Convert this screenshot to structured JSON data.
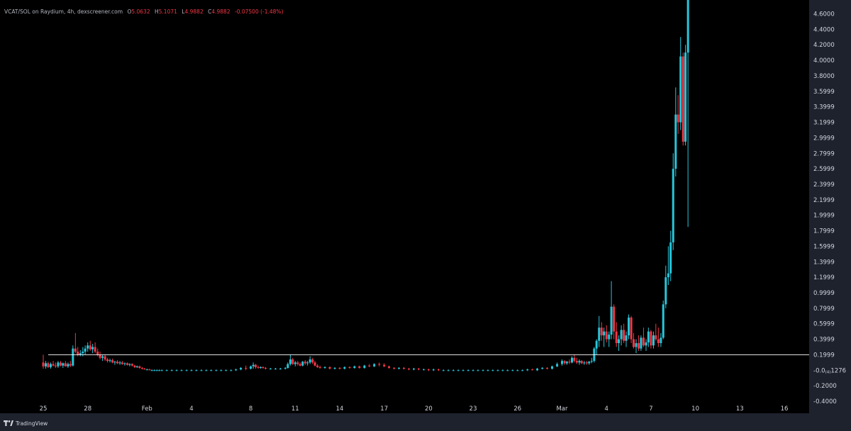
{
  "legend": {
    "symbol": "VCAT/SOL on Raydium, 4h, dexscreener.com",
    "o_label": "O",
    "o_value": "5.0632",
    "h_label": "H",
    "h_value": "5.1071",
    "l_label": "L",
    "l_value": "4.9882",
    "c_label": "C",
    "c_value": "4.9882",
    "change": "-0.07500 (-1.48%)"
  },
  "footer": {
    "brand": "TradingView"
  },
  "colors": {
    "up": "#26c6da",
    "down": "#f23645",
    "background": "#000000",
    "frame": "#1e222d",
    "axis_text": "#d1d4dc",
    "reference_line": "#ffffff"
  },
  "chart_data": {
    "type": "candlestick",
    "title": "",
    "xlabel": "",
    "ylabel": "",
    "interval": "4h",
    "y_tick_labels": [
      "4.6000",
      "4.4000",
      "4.2000",
      "4.0000",
      "3.8000",
      "3.5999",
      "3.3999",
      "3.1999",
      "2.9999",
      "2.7999",
      "2.5999",
      "2.3999",
      "2.1999",
      "1.9999",
      "1.7999",
      "1.5999",
      "1.3999",
      "1.1999",
      "0.9999",
      "0.7999",
      "0.5999",
      "0.3999",
      "0.1999",
      "-0.0001276",
      "-0.2000",
      "-0.4000"
    ],
    "y_tick_values": [
      4.6,
      4.4,
      4.2,
      4.0,
      3.8,
      3.5999,
      3.3999,
      3.1999,
      2.9999,
      2.7999,
      2.5999,
      2.3999,
      2.1999,
      1.9999,
      1.7999,
      1.5999,
      1.3999,
      1.1999,
      0.9999,
      0.7999,
      0.5999,
      0.3999,
      0.1999,
      -0.0001276,
      -0.2,
      -0.4
    ],
    "current_price_label": "-0.0001276",
    "x_tick_labels": [
      "25",
      "28",
      "Feb",
      "4",
      "8",
      "11",
      "14",
      "17",
      "20",
      "23",
      "26",
      "Mar",
      "4",
      "7",
      "10",
      "13",
      "16"
    ],
    "x_tick_days": [
      0,
      3,
      7,
      10,
      14,
      17,
      20,
      23,
      26,
      29,
      32,
      35,
      38,
      41,
      44,
      47,
      50
    ],
    "ylim": [
      -0.4,
      4.8
    ],
    "xlim_days": [
      -0.7,
      54.2
    ],
    "reference_line_value": 0.2,
    "grid": false,
    "candles_note": "approximate 4h candles; day = days since Jan 25 (first x tick)",
    "candles": [
      [
        0.0,
        0.1,
        0.2,
        0.02,
        0.05
      ],
      [
        0.17,
        0.05,
        0.12,
        0.02,
        0.09
      ],
      [
        0.33,
        0.09,
        0.11,
        0.03,
        0.04
      ],
      [
        0.5,
        0.04,
        0.1,
        0.02,
        0.08
      ],
      [
        0.67,
        0.08,
        0.12,
        0.05,
        0.06
      ],
      [
        0.83,
        0.06,
        0.1,
        0.03,
        0.05
      ],
      [
        1.0,
        0.05,
        0.12,
        0.03,
        0.1
      ],
      [
        1.17,
        0.1,
        0.12,
        0.05,
        0.06
      ],
      [
        1.33,
        0.06,
        0.1,
        0.03,
        0.09
      ],
      [
        1.5,
        0.09,
        0.12,
        0.05,
        0.05
      ],
      [
        1.67,
        0.05,
        0.1,
        0.03,
        0.08
      ],
      [
        1.83,
        0.08,
        0.12,
        0.04,
        0.06
      ],
      [
        2.0,
        0.06,
        0.32,
        0.05,
        0.28
      ],
      [
        2.17,
        0.28,
        0.48,
        0.22,
        0.24
      ],
      [
        2.33,
        0.24,
        0.3,
        0.18,
        0.2
      ],
      [
        2.5,
        0.2,
        0.26,
        0.18,
        0.22
      ],
      [
        2.67,
        0.22,
        0.3,
        0.18,
        0.24
      ],
      [
        2.83,
        0.24,
        0.32,
        0.2,
        0.28
      ],
      [
        3.0,
        0.28,
        0.36,
        0.24,
        0.32
      ],
      [
        3.17,
        0.32,
        0.38,
        0.25,
        0.27
      ],
      [
        3.33,
        0.27,
        0.34,
        0.22,
        0.3
      ],
      [
        3.5,
        0.3,
        0.36,
        0.22,
        0.24
      ],
      [
        3.67,
        0.24,
        0.28,
        0.18,
        0.2
      ],
      [
        3.83,
        0.2,
        0.24,
        0.14,
        0.16
      ],
      [
        4.0,
        0.16,
        0.2,
        0.12,
        0.18
      ],
      [
        4.17,
        0.18,
        0.2,
        0.12,
        0.14
      ],
      [
        4.33,
        0.14,
        0.16,
        0.1,
        0.12
      ],
      [
        4.5,
        0.12,
        0.15,
        0.1,
        0.13
      ],
      [
        4.67,
        0.13,
        0.15,
        0.09,
        0.1
      ],
      [
        4.83,
        0.1,
        0.12,
        0.07,
        0.11
      ],
      [
        5.0,
        0.11,
        0.13,
        0.08,
        0.09
      ],
      [
        5.17,
        0.09,
        0.12,
        0.07,
        0.1
      ],
      [
        5.33,
        0.1,
        0.12,
        0.07,
        0.08
      ],
      [
        5.5,
        0.08,
        0.1,
        0.06,
        0.09
      ],
      [
        5.67,
        0.09,
        0.1,
        0.06,
        0.07
      ],
      [
        5.83,
        0.07,
        0.09,
        0.05,
        0.08
      ],
      [
        6.0,
        0.08,
        0.09,
        0.05,
        0.06
      ],
      [
        6.17,
        0.06,
        0.07,
        0.03,
        0.04
      ],
      [
        6.33,
        0.04,
        0.06,
        0.03,
        0.05
      ],
      [
        6.5,
        0.05,
        0.06,
        0.02,
        0.03
      ],
      [
        6.67,
        0.03,
        0.04,
        0.01,
        0.02
      ],
      [
        6.83,
        0.02,
        0.03,
        0.01,
        0.01
      ],
      [
        7.0,
        0.01,
        0.02,
        0.0,
        0.01
      ],
      [
        7.17,
        0.01,
        0.02,
        0.0,
        0.0
      ],
      [
        7.33,
        0.0,
        0.01,
        -0.01,
        0.0
      ],
      [
        7.5,
        0.0,
        0.01,
        -0.01,
        0.0
      ],
      [
        7.67,
        0.0,
        0.01,
        -0.01,
        0.0
      ],
      [
        7.83,
        0.0,
        0.01,
        -0.01,
        0.0
      ],
      [
        8.0,
        0.0,
        0.01,
        -0.01,
        0.0
      ],
      [
        8.33,
        0.0,
        0.01,
        -0.01,
        0.0
      ],
      [
        8.67,
        0.0,
        0.01,
        -0.01,
        0.0
      ],
      [
        9.0,
        0.0,
        0.01,
        -0.01,
        0.0
      ],
      [
        9.33,
        0.0,
        0.01,
        -0.01,
        0.0
      ],
      [
        9.67,
        0.0,
        0.01,
        -0.01,
        0.0
      ],
      [
        10.0,
        0.0,
        0.01,
        -0.01,
        0.0
      ],
      [
        10.33,
        0.0,
        0.01,
        -0.01,
        0.0
      ],
      [
        10.67,
        0.0,
        0.01,
        -0.01,
        0.0
      ],
      [
        11.0,
        0.0,
        0.01,
        -0.01,
        0.0
      ],
      [
        11.33,
        0.0,
        0.01,
        -0.01,
        0.0
      ],
      [
        11.67,
        0.0,
        0.01,
        -0.01,
        0.0
      ],
      [
        12.0,
        0.0,
        0.01,
        -0.01,
        0.0
      ],
      [
        12.33,
        0.0,
        0.01,
        -0.01,
        0.0
      ],
      [
        12.67,
        0.0,
        0.01,
        -0.01,
        0.0
      ],
      [
        13.0,
        0.0,
        0.02,
        -0.01,
        0.01
      ],
      [
        13.33,
        0.01,
        0.04,
        0.0,
        0.03
      ],
      [
        13.67,
        0.03,
        0.06,
        0.0,
        0.02
      ],
      [
        14.0,
        0.02,
        0.06,
        0.01,
        0.05
      ],
      [
        14.17,
        0.05,
        0.1,
        0.02,
        0.07
      ],
      [
        14.33,
        0.07,
        0.08,
        0.02,
        0.04
      ],
      [
        14.5,
        0.04,
        0.06,
        0.02,
        0.03
      ],
      [
        14.67,
        0.03,
        0.05,
        0.02,
        0.04
      ],
      [
        14.83,
        0.04,
        0.05,
        0.02,
        0.03
      ],
      [
        15.0,
        0.03,
        0.04,
        0.01,
        0.02
      ],
      [
        15.33,
        0.02,
        0.03,
        0.01,
        0.02
      ],
      [
        15.67,
        0.02,
        0.03,
        0.01,
        0.02
      ],
      [
        16.0,
        0.02,
        0.03,
        0.01,
        0.02
      ],
      [
        16.33,
        0.02,
        0.04,
        0.01,
        0.03
      ],
      [
        16.5,
        0.03,
        0.1,
        0.02,
        0.08
      ],
      [
        16.67,
        0.08,
        0.2,
        0.06,
        0.14
      ],
      [
        16.83,
        0.14,
        0.16,
        0.07,
        0.08
      ],
      [
        17.0,
        0.08,
        0.12,
        0.05,
        0.1
      ],
      [
        17.17,
        0.1,
        0.12,
        0.06,
        0.08
      ],
      [
        17.33,
        0.08,
        0.1,
        0.05,
        0.06
      ],
      [
        17.5,
        0.06,
        0.12,
        0.05,
        0.11
      ],
      [
        17.67,
        0.11,
        0.13,
        0.07,
        0.09
      ],
      [
        17.83,
        0.09,
        0.12,
        0.06,
        0.1
      ],
      [
        18.0,
        0.1,
        0.18,
        0.08,
        0.14
      ],
      [
        18.17,
        0.14,
        0.16,
        0.08,
        0.1
      ],
      [
        18.33,
        0.1,
        0.12,
        0.05,
        0.06
      ],
      [
        18.5,
        0.06,
        0.08,
        0.03,
        0.04
      ],
      [
        18.67,
        0.04,
        0.06,
        0.02,
        0.03
      ],
      [
        19.0,
        0.03,
        0.05,
        0.02,
        0.04
      ],
      [
        19.33,
        0.04,
        0.05,
        0.01,
        0.02
      ],
      [
        19.67,
        0.02,
        0.04,
        0.01,
        0.03
      ],
      [
        20.0,
        0.03,
        0.04,
        0.01,
        0.02
      ],
      [
        20.33,
        0.02,
        0.05,
        0.01,
        0.04
      ],
      [
        20.67,
        0.04,
        0.05,
        0.02,
        0.03
      ],
      [
        21.0,
        0.03,
        0.06,
        0.02,
        0.05
      ],
      [
        21.33,
        0.05,
        0.06,
        0.02,
        0.03
      ],
      [
        21.67,
        0.03,
        0.07,
        0.02,
        0.06
      ],
      [
        22.0,
        0.06,
        0.08,
        0.04,
        0.05
      ],
      [
        22.33,
        0.05,
        0.09,
        0.04,
        0.08
      ],
      [
        22.67,
        0.08,
        0.1,
        0.05,
        0.07
      ],
      [
        23.0,
        0.07,
        0.09,
        0.04,
        0.05
      ],
      [
        23.33,
        0.05,
        0.06,
        0.02,
        0.03
      ],
      [
        23.67,
        0.03,
        0.04,
        0.01,
        0.02
      ],
      [
        24.0,
        0.02,
        0.04,
        0.01,
        0.03
      ],
      [
        24.33,
        0.03,
        0.04,
        0.01,
        0.02
      ],
      [
        24.67,
        0.02,
        0.03,
        0.0,
        0.01
      ],
      [
        25.0,
        0.01,
        0.03,
        0.0,
        0.02
      ],
      [
        25.33,
        0.02,
        0.03,
        0.0,
        0.01
      ],
      [
        25.67,
        0.01,
        0.02,
        0.0,
        0.01
      ],
      [
        26.0,
        0.01,
        0.02,
        -0.01,
        0.0
      ],
      [
        26.33,
        0.0,
        0.02,
        -0.01,
        0.01
      ],
      [
        26.67,
        0.01,
        0.02,
        -0.01,
        0.0
      ],
      [
        27.0,
        0.0,
        0.01,
        -0.01,
        0.0
      ],
      [
        27.33,
        0.0,
        0.01,
        -0.01,
        0.0
      ],
      [
        27.67,
        0.0,
        0.01,
        -0.01,
        0.0
      ],
      [
        28.0,
        0.0,
        0.01,
        -0.01,
        0.0
      ],
      [
        28.33,
        0.0,
        0.01,
        -0.01,
        0.0
      ],
      [
        28.67,
        0.0,
        0.01,
        -0.01,
        0.0
      ],
      [
        29.0,
        0.0,
        0.01,
        -0.01,
        0.0
      ],
      [
        29.33,
        0.0,
        0.01,
        -0.01,
        0.0
      ],
      [
        29.67,
        0.0,
        0.01,
        -0.01,
        0.0
      ],
      [
        30.0,
        0.0,
        0.01,
        -0.01,
        0.0
      ],
      [
        30.33,
        0.0,
        0.01,
        -0.01,
        0.0
      ],
      [
        30.67,
        0.0,
        0.01,
        -0.01,
        0.0
      ],
      [
        31.0,
        0.0,
        0.01,
        -0.01,
        0.0
      ],
      [
        31.33,
        0.0,
        0.01,
        -0.01,
        0.0
      ],
      [
        31.67,
        0.0,
        0.01,
        -0.01,
        0.0
      ],
      [
        32.0,
        0.0,
        0.01,
        -0.01,
        0.0
      ],
      [
        32.33,
        0.0,
        0.01,
        -0.01,
        0.0
      ],
      [
        32.67,
        0.0,
        0.02,
        -0.01,
        0.01
      ],
      [
        33.0,
        0.01,
        0.02,
        0.0,
        0.0
      ],
      [
        33.33,
        0.0,
        0.03,
        -0.01,
        0.02
      ],
      [
        33.67,
        0.02,
        0.04,
        0.01,
        0.03
      ],
      [
        34.0,
        0.03,
        0.04,
        0.01,
        0.02
      ],
      [
        34.33,
        0.02,
        0.06,
        0.01,
        0.05
      ],
      [
        34.67,
        0.05,
        0.1,
        0.04,
        0.08
      ],
      [
        35.0,
        0.08,
        0.14,
        0.06,
        0.12
      ],
      [
        35.17,
        0.12,
        0.13,
        0.07,
        0.09
      ],
      [
        35.33,
        0.09,
        0.12,
        0.07,
        0.11
      ],
      [
        35.5,
        0.11,
        0.14,
        0.08,
        0.1
      ],
      [
        35.67,
        0.1,
        0.18,
        0.09,
        0.16
      ],
      [
        35.83,
        0.16,
        0.2,
        0.1,
        0.12
      ],
      [
        36.0,
        0.12,
        0.16,
        0.08,
        0.1
      ],
      [
        36.17,
        0.1,
        0.14,
        0.07,
        0.12
      ],
      [
        36.33,
        0.12,
        0.13,
        0.08,
        0.09
      ],
      [
        36.5,
        0.09,
        0.12,
        0.07,
        0.1
      ],
      [
        36.67,
        0.1,
        0.12,
        0.07,
        0.09
      ],
      [
        36.83,
        0.09,
        0.12,
        0.07,
        0.11
      ],
      [
        37.0,
        0.11,
        0.16,
        0.09,
        0.12
      ],
      [
        37.17,
        0.12,
        0.3,
        0.1,
        0.28
      ],
      [
        37.33,
        0.28,
        0.4,
        0.2,
        0.38
      ],
      [
        37.5,
        0.38,
        0.7,
        0.3,
        0.55
      ],
      [
        37.67,
        0.55,
        0.62,
        0.38,
        0.45
      ],
      [
        37.83,
        0.45,
        0.55,
        0.3,
        0.5
      ],
      [
        38.0,
        0.5,
        0.58,
        0.36,
        0.4
      ],
      [
        38.17,
        0.4,
        0.5,
        0.3,
        0.46
      ],
      [
        38.33,
        0.46,
        1.15,
        0.4,
        0.82
      ],
      [
        38.5,
        0.82,
        0.85,
        0.4,
        0.5
      ],
      [
        38.67,
        0.5,
        0.62,
        0.3,
        0.35
      ],
      [
        38.83,
        0.35,
        0.45,
        0.25,
        0.4
      ],
      [
        39.0,
        0.4,
        0.58,
        0.32,
        0.52
      ],
      [
        39.17,
        0.52,
        0.6,
        0.35,
        0.38
      ],
      [
        39.33,
        0.38,
        0.5,
        0.3,
        0.45
      ],
      [
        39.5,
        0.45,
        0.72,
        0.4,
        0.68
      ],
      [
        39.67,
        0.68,
        0.7,
        0.35,
        0.4
      ],
      [
        39.83,
        0.4,
        0.48,
        0.28,
        0.3
      ],
      [
        40.0,
        0.3,
        0.4,
        0.22,
        0.35
      ],
      [
        40.17,
        0.35,
        0.45,
        0.25,
        0.28
      ],
      [
        40.33,
        0.28,
        0.45,
        0.25,
        0.42
      ],
      [
        40.5,
        0.42,
        0.55,
        0.3,
        0.32
      ],
      [
        40.67,
        0.32,
        0.4,
        0.25,
        0.36
      ],
      [
        40.83,
        0.36,
        0.55,
        0.3,
        0.5
      ],
      [
        41.0,
        0.5,
        0.52,
        0.28,
        0.32
      ],
      [
        41.17,
        0.32,
        0.5,
        0.28,
        0.45
      ],
      [
        41.33,
        0.45,
        0.6,
        0.38,
        0.4
      ],
      [
        41.5,
        0.4,
        0.55,
        0.3,
        0.35
      ],
      [
        41.67,
        0.35,
        0.48,
        0.3,
        0.42
      ],
      [
        41.83,
        0.42,
        0.9,
        0.4,
        0.85
      ],
      [
        42.0,
        0.85,
        1.35,
        0.8,
        1.2
      ],
      [
        42.17,
        1.2,
        1.6,
        1.1,
        1.25
      ],
      [
        42.33,
        1.25,
        1.8,
        1.15,
        1.65
      ],
      [
        42.5,
        1.65,
        2.8,
        1.55,
        2.6
      ],
      [
        42.67,
        2.6,
        3.65,
        2.5,
        3.3
      ],
      [
        42.83,
        3.3,
        3.55,
        3.05,
        3.2
      ],
      [
        43.0,
        3.2,
        4.3,
        3.1,
        4.05
      ],
      [
        43.17,
        4.05,
        4.1,
        2.9,
        2.95
      ],
      [
        43.33,
        2.95,
        4.2,
        2.9,
        4.1
      ],
      [
        43.5,
        4.1,
        4.9,
        1.85,
        4.8
      ]
    ]
  }
}
